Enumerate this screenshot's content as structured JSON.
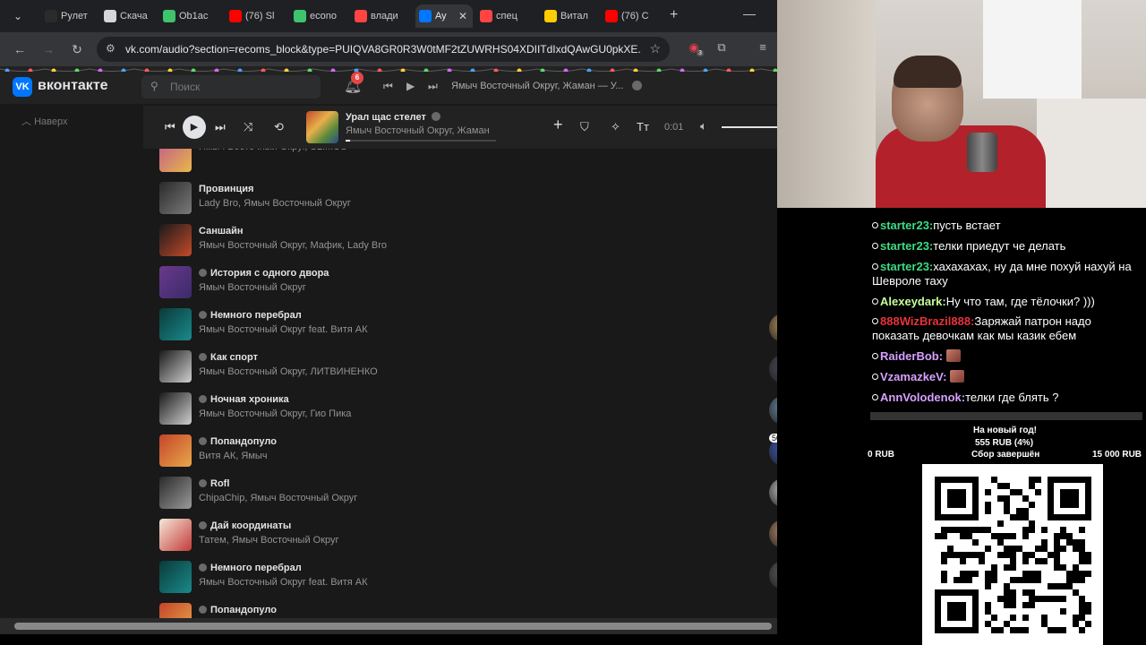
{
  "browser": {
    "tabs": [
      {
        "label": "Рулет",
        "color": "#2b2b2b"
      },
      {
        "label": "Скача",
        "color": "#d6d6d6"
      },
      {
        "label": "Ob1ac",
        "color": "#3ec46d"
      },
      {
        "label": "(76) Sl",
        "color": "#ff0000"
      },
      {
        "label": "econo",
        "color": "#3ec46d"
      },
      {
        "label": "влади",
        "color": "#ff4444"
      },
      {
        "label": "Ay",
        "color": "#0077ff"
      },
      {
        "label": "спец",
        "color": "#ff4444"
      },
      {
        "label": "Витал",
        "color": "#ffcc00"
      },
      {
        "label": "(76) C",
        "color": "#ff0000"
      }
    ],
    "url": "vk.com/audio?section=recoms_block&type=PUIQVA8GR0R3W0tMF2tZUWRHS04XDIITdIxdQAwGU0pkXE...",
    "ext_badge": "3"
  },
  "vk": {
    "logo_text": "вконтакте",
    "search_placeholder": "Поиск",
    "notif_count": "6",
    "header_now_playing": "Ямыч Восточный Округ, Жаман — У...",
    "up_link": "Наверх",
    "player": {
      "title": "Урал щас стелет",
      "artist": "Ямыч Восточный Округ, Жаман",
      "time": "0:01",
      "progress": 0.01
    },
    "tracks": [
      {
        "title": "",
        "artist": "Ямыч Восточный Округ, SLIMUS",
        "dot": false,
        "c1": "#c05a8a",
        "c2": "#e8b84a"
      },
      {
        "title": "Провинция",
        "artist": "Lady Bro, Ямыч Восточный Округ",
        "dot": false,
        "c1": "#2a2a2a",
        "c2": "#7a7a7a"
      },
      {
        "title": "Саншайн",
        "artist": "Ямыч Восточный Округ, Мафик, Lady Bro",
        "dot": false,
        "c1": "#1a1a1a",
        "c2": "#c44a2a"
      },
      {
        "title": "История с одного двора",
        "artist": "Ямыч Восточный Округ",
        "dot": true,
        "c1": "#6a3a8a",
        "c2": "#3a2a6a"
      },
      {
        "title": "Немного перебрал",
        "artist": "Ямыч Восточный Округ feat. Витя АК",
        "dot": true,
        "c1": "#0a3a3a",
        "c2": "#1a8a8a"
      },
      {
        "title": "Как спорт",
        "artist": "Ямыч Восточный Округ, ЛИТВИНЕНКО",
        "dot": true,
        "c1": "#1a1a1a",
        "c2": "#d0d0d0"
      },
      {
        "title": "Ночная хроника",
        "artist": "Ямыч Восточный Округ, Гио Пика",
        "dot": true,
        "c1": "#1a1a1a",
        "c2": "#d0d0d0"
      },
      {
        "title": "Попандопуло",
        "artist": "Витя АК, Ямыч",
        "dot": true,
        "c1": "#c4442a",
        "c2": "#e8a84a"
      },
      {
        "title": "Rofl",
        "artist": "ChipaChip, Ямыч Восточный Округ",
        "dot": true,
        "c1": "#2a2a2a",
        "c2": "#9a9a9a"
      },
      {
        "title": "Дай координаты",
        "artist": "Татем, Ямыч Восточный Округ",
        "dot": true,
        "c1": "#f4e8d8",
        "c2": "#c43a3a"
      },
      {
        "title": "Немного перебрал",
        "artist": "Ямыч Восточный Округ feat. Витя АК",
        "dot": true,
        "c1": "#0a3a3a",
        "c2": "#1a8a8a"
      },
      {
        "title": "Попандопуло",
        "artist": "Витя АК, Ямыч",
        "dot": true,
        "c1": "#c4442a",
        "c2": "#e8a84a"
      }
    ],
    "rail": {
      "times": [
        "3:3",
        "3:1",
        "3:0",
        "3:1",
        "3:2",
        "3:1",
        "3:0",
        "2:2",
        "3:0",
        "3:1"
      ],
      "badge": "508"
    }
  },
  "chat": [
    {
      "nick": "starter23:",
      "text": "пусть встает",
      "color": "#3ddc84",
      "bullet": true,
      "emote": false
    },
    {
      "nick": "starter23:",
      "text": "телки приедут че делать",
      "color": "#3ddc84",
      "bullet": true,
      "emote": false
    },
    {
      "nick": "starter23:",
      "text": "хахахахах, ну да мне похуй нахуй на Шевроле таху",
      "color": "#3ddc84",
      "bullet": true,
      "emote": false
    },
    {
      "nick": "Alexeydark:",
      "text": "Ну что там, где тёлочки? )))",
      "color": "#c8ff9a",
      "bullet": true,
      "emote": false
    },
    {
      "nick": "888WizBrazil888:",
      "text": "Заряжай патрон надо показать девочкам как мы казик ебем",
      "color": "#e8323c",
      "bullet": true,
      "emote": false
    },
    {
      "nick": "RaiderBob:",
      "text": "",
      "color": "#d6a0ff",
      "bullet": true,
      "emote": true
    },
    {
      "nick": "VzamazkeV:",
      "text": "",
      "color": "#d6a0ff",
      "bullet": true,
      "emote": true
    },
    {
      "nick": "AnnVolodenok:",
      "text": "телки где блять ?",
      "color": "#d6a0ff",
      "bullet": true,
      "emote": false
    }
  ],
  "donation": {
    "goal": "На новый год!",
    "raised": "555 RUB (4%)",
    "min": "0 RUB",
    "status": "Сбор завершён",
    "max": "15 000 RUB"
  }
}
